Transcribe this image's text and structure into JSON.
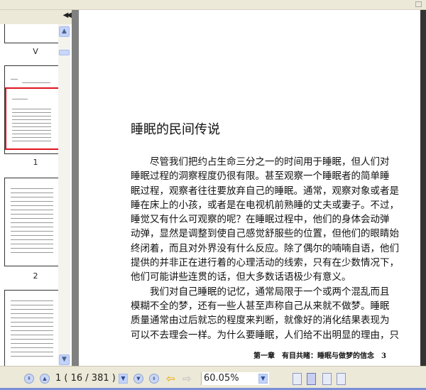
{
  "thumbnails": [
    {
      "label": "V"
    },
    {
      "label": "1",
      "selected": true
    },
    {
      "label": "2"
    }
  ],
  "document": {
    "title": "睡眠的民间传说",
    "paragraphs": [
      [
        "尽管我们把约占生命三分之一的时间用于睡眠，但人们对",
        "睡眠过程的洞察程度仍很有限。甚至观察一个睡眠者的简单睡",
        "眠过程，观察者往往要放弃自己的睡眠。通常，观察对象或者是",
        "睡在床上的小孩，或者是在电视机前熟睡的丈夫或妻子。不过，",
        "睡觉又有什么可观察的呢？在睡眠过程中，他们的身体会动弹",
        "动弹，显然是调整到使自己感觉舒服些的位置，但他们的眼睛始",
        "终闭着，而且对外界没有什么反应。除了偶尔的喃喃自语，他们",
        "提供的并非正在进行着的心理活动的线索，只有在少数情况下，",
        "他们可能讲些连贯的话，但大多数话语极少有意义。"
      ],
      [
        "我们对自己睡眠的记忆，通常局限于一个或两个混乱而且",
        "模糊不全的梦，还有一些人甚至声称自己从来就不做梦。睡眠",
        "质量通常由过后就忘的程度来判断，就像好的消化结果表现为",
        "可以不去理会一样。为什么要睡眠，人们给不出明显的理由，只"
      ]
    ],
    "footer": "第一章　有目共睹：睡眠与做梦的信念　3"
  },
  "toolbar": {
    "page_indicator": "1 ( 16 / 381 )",
    "zoom": "60.05%"
  }
}
